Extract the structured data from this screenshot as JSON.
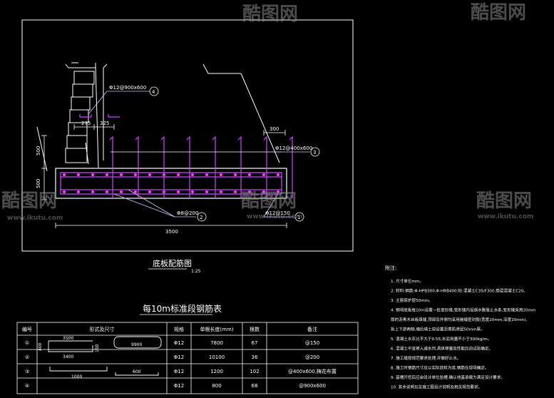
{
  "drawing": {
    "title": "底板配筋图",
    "scale": "1:25",
    "dims": {
      "d275": "275",
      "d325": "325",
      "d300": "300",
      "d500a": "500",
      "d500b": "500",
      "d3500": "3500"
    },
    "callouts": [
      {
        "text": "Φ12@900x600",
        "num": "4"
      },
      {
        "text": "Φ12@400x600",
        "num": "3"
      },
      {
        "text": "Φ8@200",
        "num": "2"
      },
      {
        "text": "Φ12@150",
        "num": "1"
      }
    ]
  },
  "table": {
    "title": "每10m标准段钢筋表",
    "headers": [
      "编号",
      "形式及尺寸",
      "规格",
      "单根长度(mm)",
      "根数",
      "备注"
    ],
    "rows": [
      {
        "no": "①",
        "spec": "Φ12",
        "length": "7800",
        "count": "67",
        "note": "@150"
      },
      {
        "no": "②",
        "spec": "Φ12",
        "length": "10100",
        "count": "36",
        "note": "@200"
      },
      {
        "no": "③",
        "spec": "Φ12",
        "length": "1200",
        "count": "102",
        "note": "@400x600,梅花布置"
      },
      {
        "no": "④",
        "spec": "Φ12",
        "length": "800",
        "count": "68",
        "note": "@900x600"
      }
    ],
    "shape_dims": {
      "r1_top": "3500",
      "r1_bottom": "3400",
      "r1_left": "400",
      "r1_right": "150",
      "r2": "9900",
      "r3": "1000",
      "r4": "600"
    }
  },
  "notes": {
    "title": "附注:",
    "items": [
      "1. 尺寸单位mm。",
      "2. 材料:钢筋:Φ-HPB300,Φ-HRB400;砼:混凝土C35/F300,垫层混凝土C20。",
      "3. 主筋保护层50mm。",
      "4. 钢坝底板每10m设置一处变形缝,变形缝内设遇水膨胀止水条,变形缝采用20mm",
      "   厚的沥青木丝板填缝,顶部及外侧均采用嵌缝密封胶(宽度20mm,深度20mm),",
      "   拆上下游两侧,墙后填土前设置沥青防渗层50mm厚。",
      "5. 混凝土水灰比不大于0.55;水泥用量不小于300kg/m。",
      "6. 混凝土中宜掺入减水剂,具体掺量及性能应由试验确定。",
      "7. 施工缝按规范要求处理,并做好止水。",
      "8. 施工时钢筋尺寸应以实际放样为准,钢筋在现场确定。",
      "9. 基槽开挖后应由设计单位验槽,确认地基承载力满足设计要求。",
      "10. 其余说明见总施工图设计说明及相关规范要求。"
    ]
  },
  "watermark": {
    "brand": "酷图网",
    "url": "www.ikutu.com"
  },
  "colors": {
    "bg": "#000000",
    "line": "#ffffff",
    "rebar": "#d040ff",
    "dot": "#ff40ff",
    "callout": "#c8c8ff",
    "red_note": "#ff3030"
  }
}
